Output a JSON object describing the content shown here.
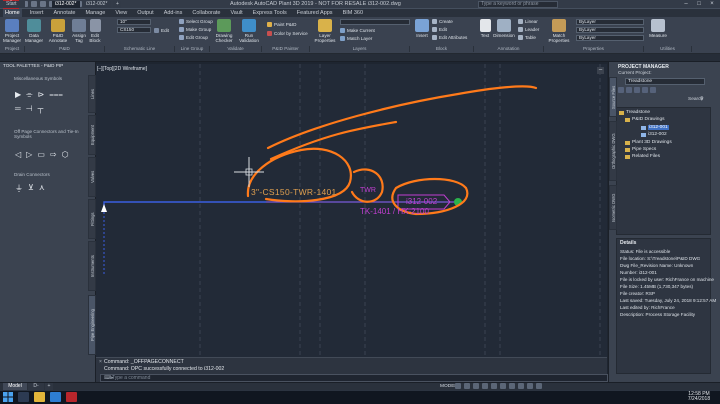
{
  "window": {
    "logo": "A",
    "title": "Autodesk AutoCAD Plant 3D 2019 - NOT FOR RESALE  i312-002.dwg",
    "signin_placeholder": "Type a keyword or phrase",
    "win_buttons": [
      "–",
      "□",
      "×"
    ]
  },
  "menubar": {
    "items": [
      "Home",
      "Insert",
      "Annotate",
      "Manage",
      "View",
      "Output",
      "Add-ins",
      "Collaborate",
      "Vault",
      "Express Tools",
      "Featured Apps",
      "BIM 360"
    ],
    "active": "Home"
  },
  "ribbon": {
    "project_manager": "Project Manager",
    "data_manager": "Data Manager",
    "pid_annotate": "P&ID Annotate",
    "assign_tag": "Assign Tag",
    "edit_block": "Edit Block",
    "line_size": "10\"",
    "line_spec": "CS150",
    "edit": "Edit",
    "select_group": "Select Group",
    "make_group": "Make Group",
    "edit_group": "Edit Group",
    "drawing_checker": "Drawing Checker",
    "run_validation": "Run Validation",
    "paint_pid": "Paint P&ID",
    "color_by_service": "Color by Service",
    "layer_properties": "Layer Properties",
    "make_current": "Make Current",
    "match_layer": "Match Layer",
    "insert": "Insert",
    "create": "Create",
    "edit_blk": "Edit",
    "edit_attributes": "Edit Attributes",
    "text": "Text",
    "dimension": "Dimension",
    "linear": "Linear",
    "leader": "Leader",
    "table": "Table",
    "match_properties": "Match Properties",
    "bylayer1": "ByLayer",
    "bylayer2": "ByLayer",
    "bylayer3": "ByLayer",
    "measure": "Measure",
    "panels": [
      "Project",
      "P&ID",
      "Schematic Line",
      "Line Group",
      "Validate",
      "P&ID Painter",
      "Layers",
      "Block",
      "Annotation",
      "Properties",
      "Utilities"
    ]
  },
  "filetabs": {
    "start": "Start",
    "file1": "i312-002*",
    "file2": "i312-002*",
    "add": "+"
  },
  "toolpalette": {
    "header": "TOOL PALETTES - P&ID PIP",
    "section1": "Miscellaneous Symbols",
    "section2": "Off Page Connectors and Tie-In Symbols",
    "section3": "Drain Connectors",
    "side_tabs": [
      "Lines",
      "Equipment",
      "Valves",
      "Fittings",
      "Instruments",
      "Pipe Engineering"
    ]
  },
  "canvas": {
    "viewport_label": "[–][Top][2D Wireframe]",
    "line_tag": "3\"-CS150-TWR-1401",
    "twr_label": "TWR",
    "tk_label": "TK-1401 / HX-2100",
    "opc_label": "i312-002",
    "close": "–"
  },
  "cmdline": {
    "close": "×",
    "line1": "Command:  _OFFPAGECONNECT",
    "line2": "Command:  OPC successfully connected to i312-002",
    "prompt": "⌨▸",
    "placeholder": "Type a command"
  },
  "project_manager": {
    "title": "PROJECT MANAGER",
    "current_project_label": "Current Project:",
    "current_project": "Treadstone",
    "search_label": "Search",
    "tree": [
      {
        "label": "Treadstone",
        "indent": 0
      },
      {
        "label": "P&ID Drawings",
        "indent": 1
      },
      {
        "label": "i312-001",
        "indent": 2,
        "selected": true
      },
      {
        "label": "i312-002",
        "indent": 2
      },
      {
        "label": "Plant 3D Drawings",
        "indent": 1
      },
      {
        "label": "Pipe Specs",
        "indent": 1
      },
      {
        "label": "Related Files",
        "indent": 1
      }
    ],
    "side_tabs": [
      "Source Files",
      "Orthographic DWG",
      "Isometric DWG"
    ],
    "details_title": "Details",
    "details": [
      "Status: File is accessible",
      "File location: S:\\Treadstone\\P&ID DWG",
      "Dwg File_Revision Name: Unknown",
      "Number: i312-001",
      "File is locked by user: RichFrance on machine",
      "File Size: 1.45MB (1,730,347 bytes)",
      "File creator: RSP",
      "Last saved: Tuesday, July 24, 2018 9:12:57 AM",
      "Last edited by: RichFrance",
      "Description: Process Storage Facility"
    ]
  },
  "statusbar": {
    "model_tab": "Model",
    "layout_tab": "D-DWG",
    "plus": "+",
    "model_label": "MODEL"
  },
  "taskbar": {
    "time": "12:58 PM",
    "date": "7/24/2018"
  },
  "colors": {
    "annotation": "#ff7a1a",
    "pid_line": "#3a5ee0",
    "tag_text": "#e0a050",
    "magenta": "#c03fd0",
    "connector_green": "#2bb24c"
  }
}
